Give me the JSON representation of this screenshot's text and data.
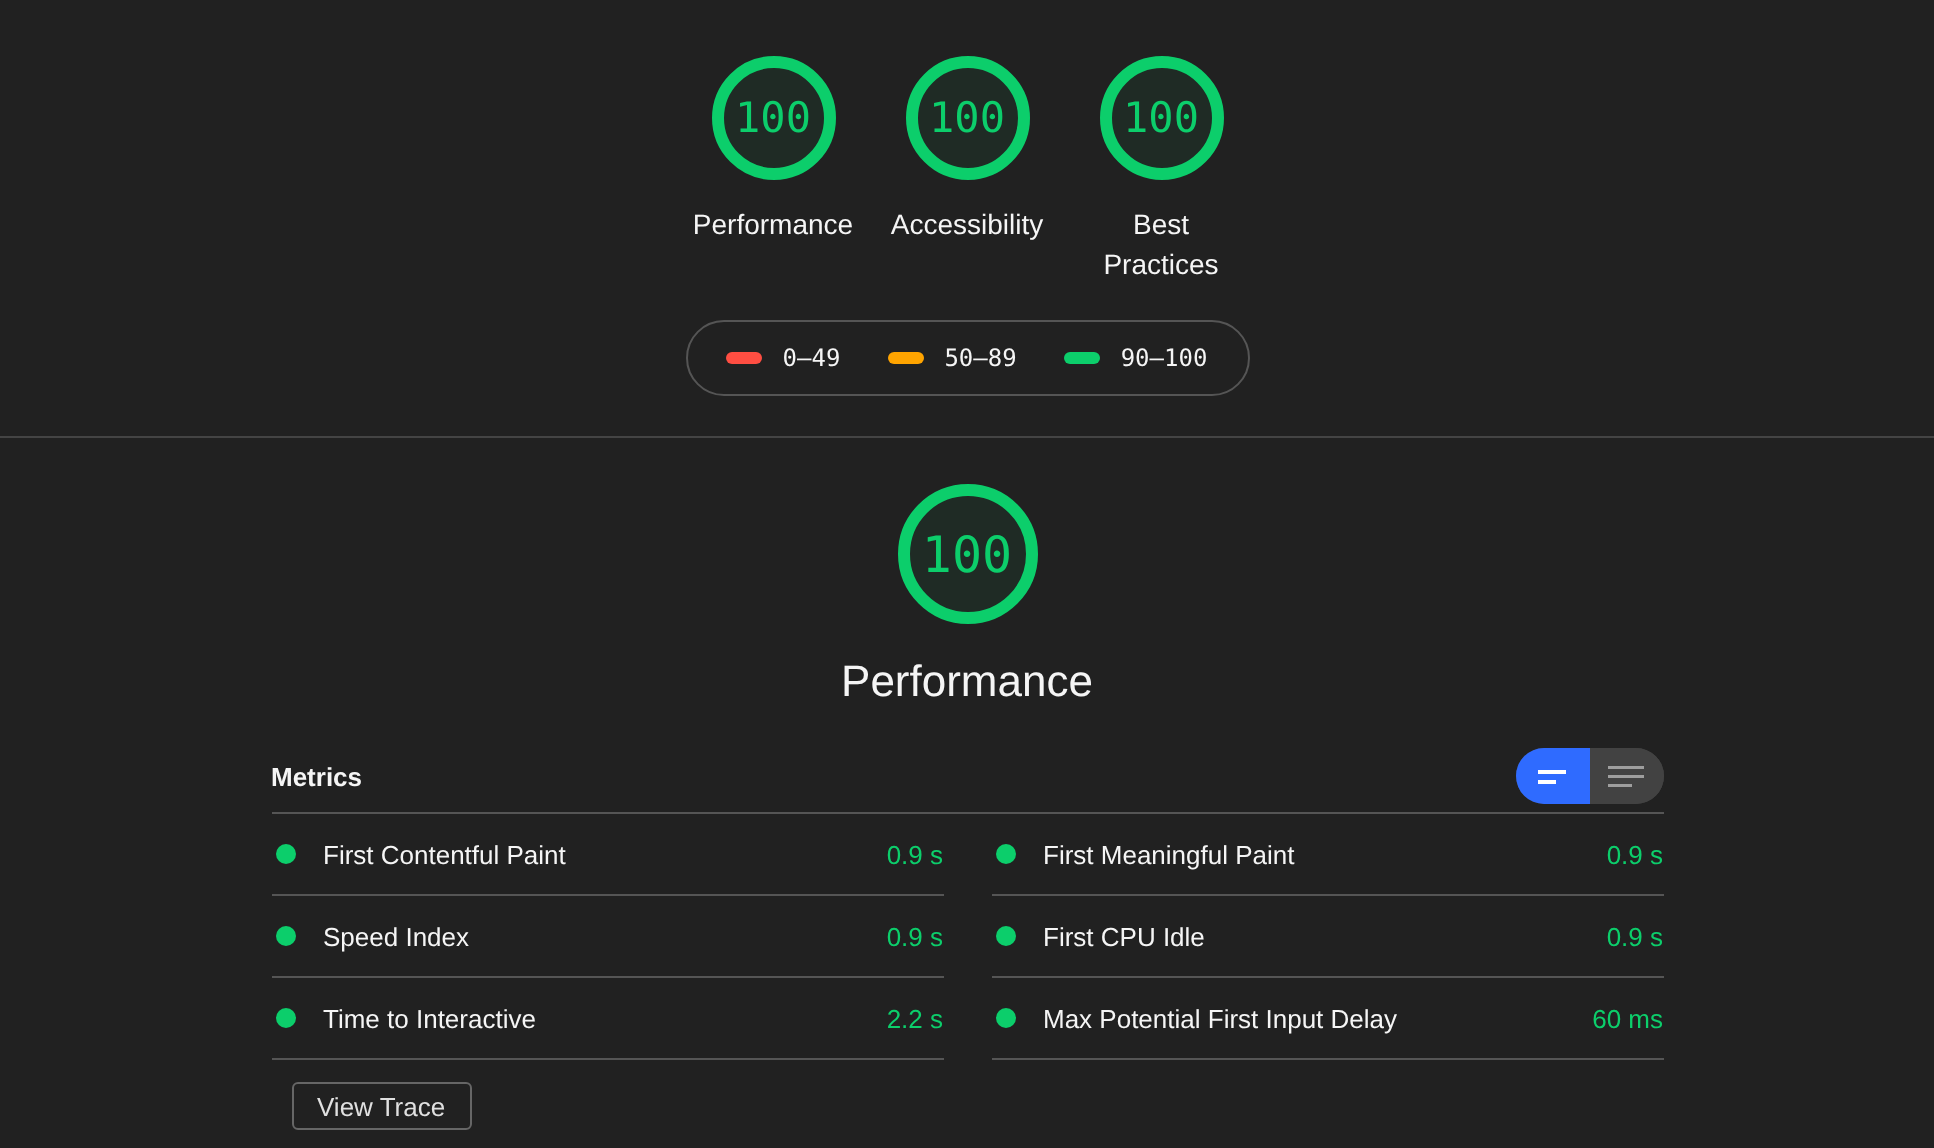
{
  "categories": [
    {
      "score": "100",
      "label": "Performance"
    },
    {
      "score": "100",
      "label": "Accessibility"
    },
    {
      "score": "100",
      "label": "Best Practices"
    }
  ],
  "legend": [
    {
      "range": "0–49",
      "color": "#ff4e42"
    },
    {
      "range": "50–89",
      "color": "#ffa400"
    },
    {
      "range": "90–100",
      "color": "#0cce6b"
    }
  ],
  "section": {
    "score": "100",
    "title": "Performance"
  },
  "metrics_header": {
    "title": "Metrics",
    "view_toggle": [
      {
        "kind": "compact",
        "selected": true
      },
      {
        "kind": "expanded",
        "selected": false
      }
    ]
  },
  "metrics": [
    {
      "name": "First Contentful Paint",
      "value": "0.9 s",
      "color": "#0cce6b"
    },
    {
      "name": "First Meaningful Paint",
      "value": "0.9 s",
      "color": "#0cce6b"
    },
    {
      "name": "Speed Index",
      "value": "0.9 s",
      "color": "#0cce6b"
    },
    {
      "name": "First CPU Idle",
      "value": "0.9 s",
      "color": "#0cce6b"
    },
    {
      "name": "Time to Interactive",
      "value": "2.2 s",
      "color": "#0cce6b"
    },
    {
      "name": "Max Potential First Input Delay",
      "value": "60 ms",
      "color": "#0cce6b"
    }
  ],
  "view_trace_button": "View Trace"
}
